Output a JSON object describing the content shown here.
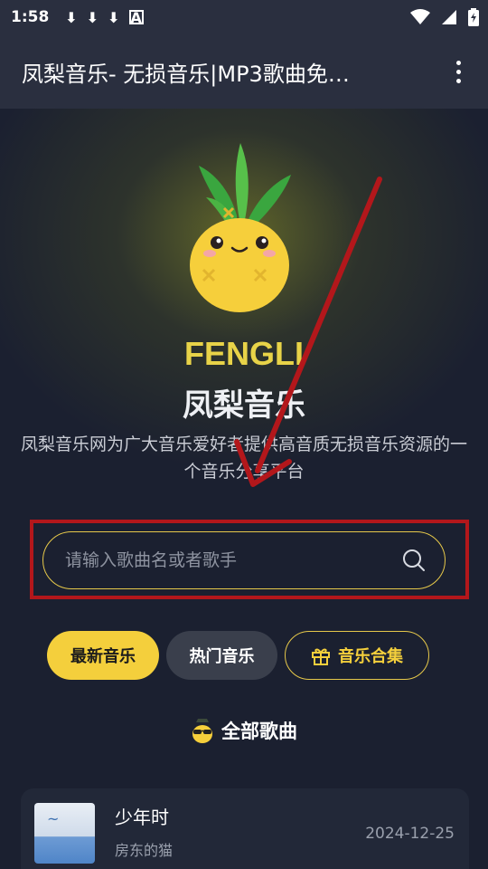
{
  "status_bar": {
    "time": "1:58",
    "icons": [
      "download-icon",
      "download-icon",
      "download-icon",
      "a-icon",
      "wifi-icon",
      "signal-icon",
      "battery-charging-icon"
    ],
    "a_label": "A"
  },
  "app_bar": {
    "title": "凤梨音乐- 无损音乐|MP3歌曲免…",
    "menu_icon": "more-vert-icon"
  },
  "hero": {
    "brand_en": "FENGLI",
    "brand_cn": "凤梨音乐",
    "description": "凤梨音乐网为广大音乐爱好者提供高音质无损音乐资源的一个音乐分享平台"
  },
  "search": {
    "placeholder": "请输入歌曲名或者歌手",
    "icon": "search-icon"
  },
  "tabs": [
    {
      "label": "最新音乐",
      "state": "active"
    },
    {
      "label": "热门音乐",
      "state": "normal"
    },
    {
      "label": "音乐合集",
      "state": "outline",
      "icon": "gift-icon"
    }
  ],
  "section": {
    "title": "全部歌曲",
    "icon": "pineapple-sunglasses-icon"
  },
  "songs": [
    {
      "name": "少年时",
      "artist": "房东的猫",
      "date": "2024-12-25"
    }
  ],
  "colors": {
    "accent": "#f4cf3c",
    "background": "#1b2030",
    "appbar": "#2a2f3f",
    "annotation_red": "#b3171b"
  }
}
